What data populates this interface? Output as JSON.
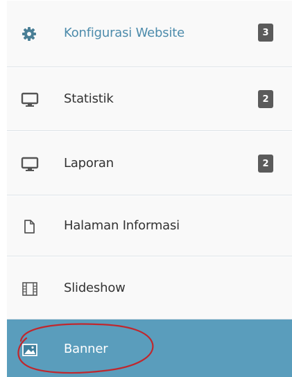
{
  "sidebar": {
    "items": [
      {
        "icon": "gear-icon",
        "label": "Konfigurasi Website",
        "badge": "3",
        "highlighted": true,
        "active": false
      },
      {
        "icon": "monitor-icon",
        "label": "Statistik",
        "badge": "2",
        "highlighted": false,
        "active": false
      },
      {
        "icon": "monitor-icon",
        "label": "Laporan",
        "badge": "2",
        "highlighted": false,
        "active": false
      },
      {
        "icon": "document-icon",
        "label": "Halaman Informasi",
        "badge": "",
        "highlighted": false,
        "active": false
      },
      {
        "icon": "film-icon",
        "label": "Slideshow",
        "badge": "",
        "highlighted": false,
        "active": false
      },
      {
        "icon": "image-icon",
        "label": "Banner",
        "badge": "",
        "highlighted": false,
        "active": true
      }
    ]
  },
  "colors": {
    "active_background": "#5a9dbc",
    "highlight_text": "#4c8bab",
    "badge_background": "#5b5b5b",
    "annotation_circle": "#c0272d"
  }
}
